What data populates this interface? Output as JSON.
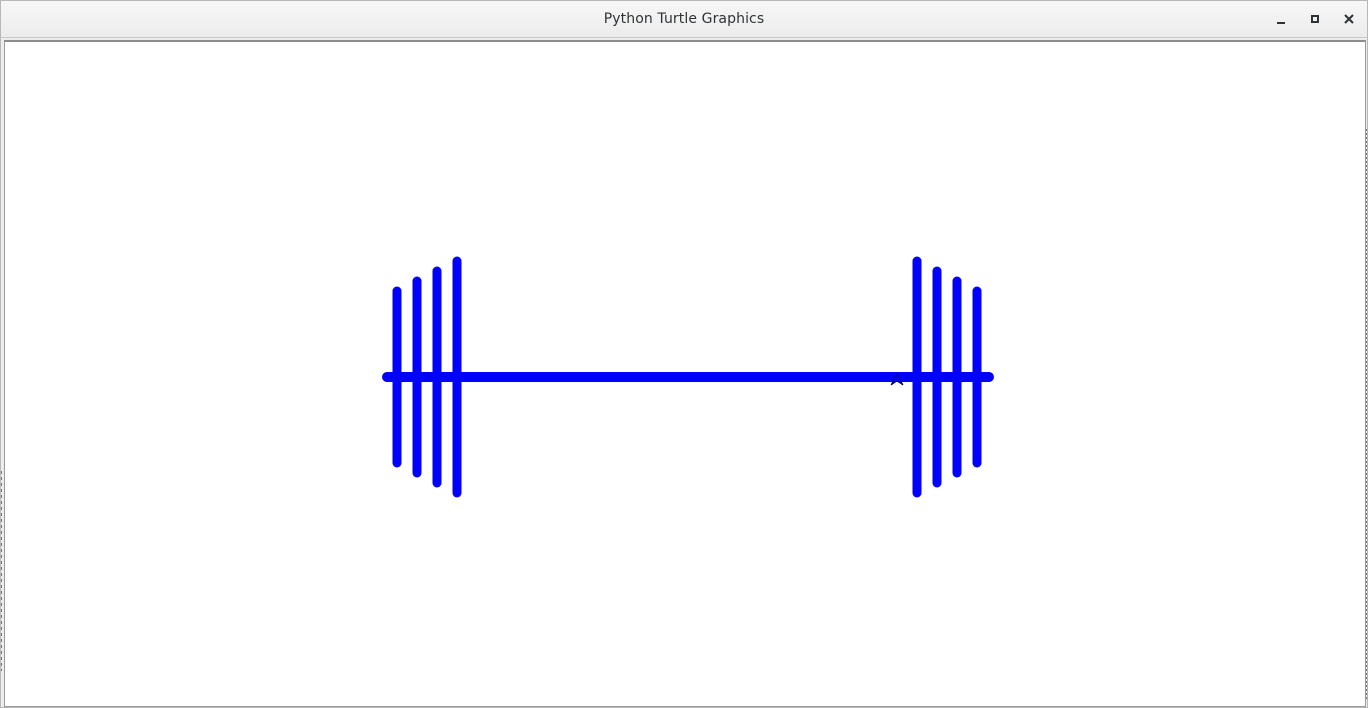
{
  "window": {
    "title": "Python Turtle Graphics"
  },
  "controls": {
    "minimize_icon": "minimize-icon",
    "maximize_icon": "maximize-icon",
    "close_icon": "close-icon"
  },
  "drawing": {
    "stroke_color": "#0000ff",
    "turtle_color": "#000080",
    "shape": "dumbbell"
  }
}
